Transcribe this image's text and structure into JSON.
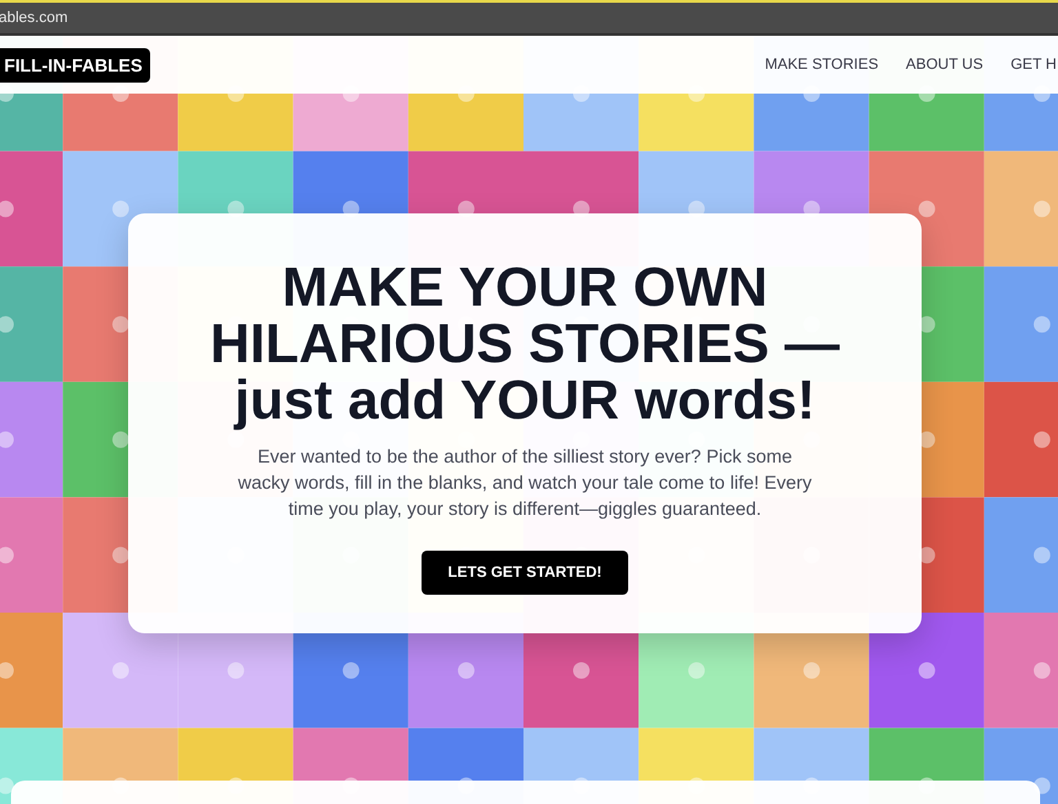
{
  "browser": {
    "url": "ables.com"
  },
  "header": {
    "logo": "FILL-IN-FABLES",
    "nav": [
      "MAKE STORIES",
      "ABOUT US",
      "GET H"
    ]
  },
  "hero": {
    "title_lines": [
      "MAKE YOUR OWN",
      "HILARIOUS STORIES —",
      "just add YOUR words!"
    ],
    "text": "Ever wanted to be the author of the silliest story ever? Pick some wacky words, fill in the blanks, and watch your tale come to life! Every time you play, your story is different—giggles guaranteed.",
    "button": "LETS GET STARTED!"
  }
}
